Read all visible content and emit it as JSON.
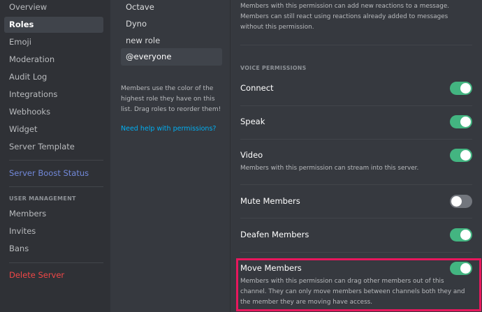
{
  "sidebar": {
    "items": [
      {
        "label": "Overview"
      },
      {
        "label": "Roles"
      },
      {
        "label": "Emoji"
      },
      {
        "label": "Moderation"
      },
      {
        "label": "Audit Log"
      },
      {
        "label": "Integrations"
      },
      {
        "label": "Webhooks"
      },
      {
        "label": "Widget"
      },
      {
        "label": "Server Template"
      }
    ],
    "boost_label": "Server Boost Status",
    "user_mgmt_header": "USER MANAGEMENT",
    "user_mgmt_items": [
      {
        "label": "Members"
      },
      {
        "label": "Invites"
      },
      {
        "label": "Bans"
      }
    ],
    "delete_label": "Delete Server",
    "selected": "Roles"
  },
  "roles": {
    "items": [
      {
        "label": "Octave"
      },
      {
        "label": "Dyno"
      },
      {
        "label": "new role"
      },
      {
        "label": "@everyone"
      }
    ],
    "selected": "@everyone",
    "hint": "Members use the color of the highest role they have on this list. Drag roles to reorder them!",
    "help_link": "Need help with permissions?"
  },
  "permissions": {
    "top_description": "Members with this permission can add new reactions to a message. Members can still react using reactions already added to messages without this permission.",
    "section_title": "VOICE PERMISSIONS",
    "items": [
      {
        "name": "Connect",
        "enabled": true,
        "description": ""
      },
      {
        "name": "Speak",
        "enabled": true,
        "description": ""
      },
      {
        "name": "Video",
        "enabled": true,
        "description": "Members with this permission can stream into this server."
      },
      {
        "name": "Mute Members",
        "enabled": false,
        "description": ""
      },
      {
        "name": "Deafen Members",
        "enabled": true,
        "description": ""
      },
      {
        "name": "Move Members",
        "enabled": true,
        "description": "Members with this permission can drag other members out of this channel. They can only move members between channels both they and the member they are moving have access."
      }
    ]
  },
  "colors": {
    "toggle_on": "#43b581",
    "toggle_off": "#72767d",
    "highlight": "#e8175d",
    "link": "#00b0f4",
    "boost": "#7289da",
    "danger": "#f04747"
  }
}
